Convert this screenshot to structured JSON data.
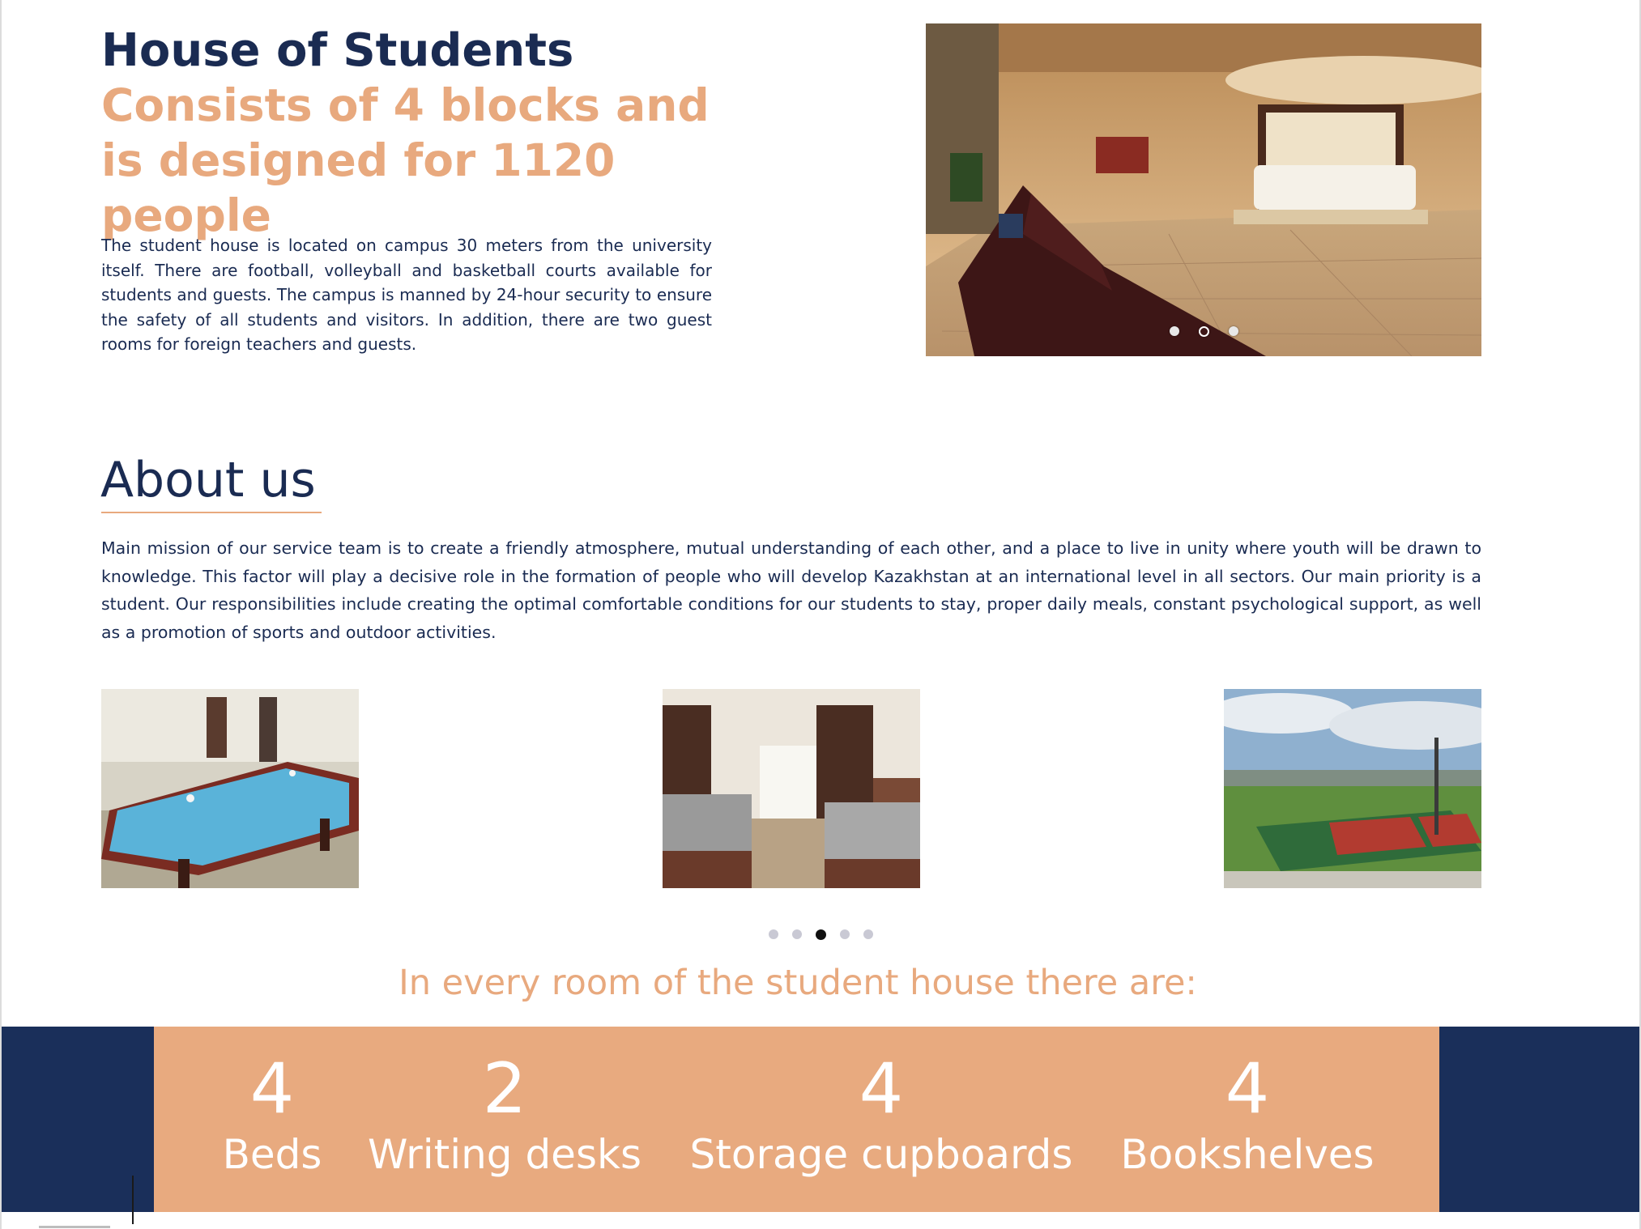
{
  "hero": {
    "title": "House of Students",
    "subtitle": "Consists of 4 blocks and is designed for 1120 people",
    "description": "The student house is located on campus 30 meters from the university itself. There are football, volleyball and basketball courts available for students and guests. The campus is manned by 24-hour security to ensure the safety of all students and visitors. In addition, there are two guest rooms for foreign teachers and guests.",
    "slider": {
      "slides": 3,
      "active_index": 1
    }
  },
  "about": {
    "title": "About us",
    "text": "Main mission of our service team is to create a friendly atmosphere, mutual understanding of each other, and a place to live in unity where youth will be drawn to knowledge. This factor will play a decisive role in the formation of people who will develop Kazakhstan at an international level in all sectors. Our main priority is a student. Our responsibilities include creating the optimal comfortable conditions for our students to stay, proper daily meals, constant psychological support, as well as a promotion of sports and outdoor activities."
  },
  "gallery": {
    "images": [
      "billiard-room-photo",
      "dorm-room-photo",
      "sports-courts-photo"
    ],
    "slides": 5,
    "active_index": 2
  },
  "room": {
    "heading": "In every room of the student house there are:",
    "stats": [
      {
        "value": "4",
        "label": "Beds"
      },
      {
        "value": "2",
        "label": "Writing desks"
      },
      {
        "value": "4",
        "label": "Storage cupboards"
      },
      {
        "value": "4",
        "label": "Bookshelves"
      }
    ]
  },
  "colors": {
    "navy": "#1a2b52",
    "peach": "#e8a97e",
    "band_navy": "#1a2f5a",
    "band_peach": "#e8aa7f"
  }
}
